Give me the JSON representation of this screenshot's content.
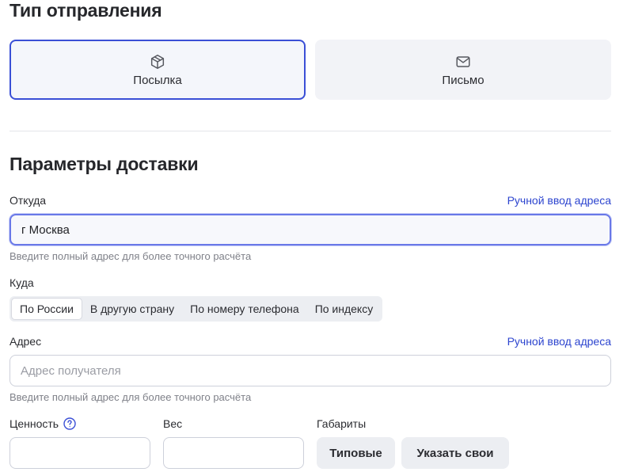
{
  "shipment_type": {
    "title": "Тип отправления",
    "options": [
      {
        "label": "Посылка",
        "icon": "package-icon",
        "selected": true
      },
      {
        "label": "Письмо",
        "icon": "envelope-icon",
        "selected": false
      }
    ]
  },
  "delivery": {
    "title": "Параметры доставки",
    "from": {
      "label": "Откуда",
      "manual_link": "Ручной ввод адреса",
      "value": "г Москва",
      "hint": "Введите полный адрес для более точного расчёта"
    },
    "to": {
      "label": "Куда",
      "tabs": [
        {
          "label": "По России",
          "selected": true
        },
        {
          "label": "В другую страну",
          "selected": false
        },
        {
          "label": "По номеру телефона",
          "selected": false
        },
        {
          "label": "По индексу",
          "selected": false
        }
      ]
    },
    "address": {
      "label": "Адрес",
      "manual_link": "Ручной ввод адреса",
      "placeholder": "Адрес получателя",
      "hint": "Введите полный адрес для более точного расчёта"
    },
    "value_field": {
      "label": "Ценность",
      "icon": "question-circle-icon"
    },
    "weight_field": {
      "label": "Вес"
    },
    "dimensions": {
      "label": "Габариты",
      "standard_button": "Типовые",
      "custom_button": "Указать свои"
    }
  },
  "colors": {
    "accent": "#3a4fd6",
    "link": "#2d45cf",
    "card_bg": "#f2f3f7"
  }
}
